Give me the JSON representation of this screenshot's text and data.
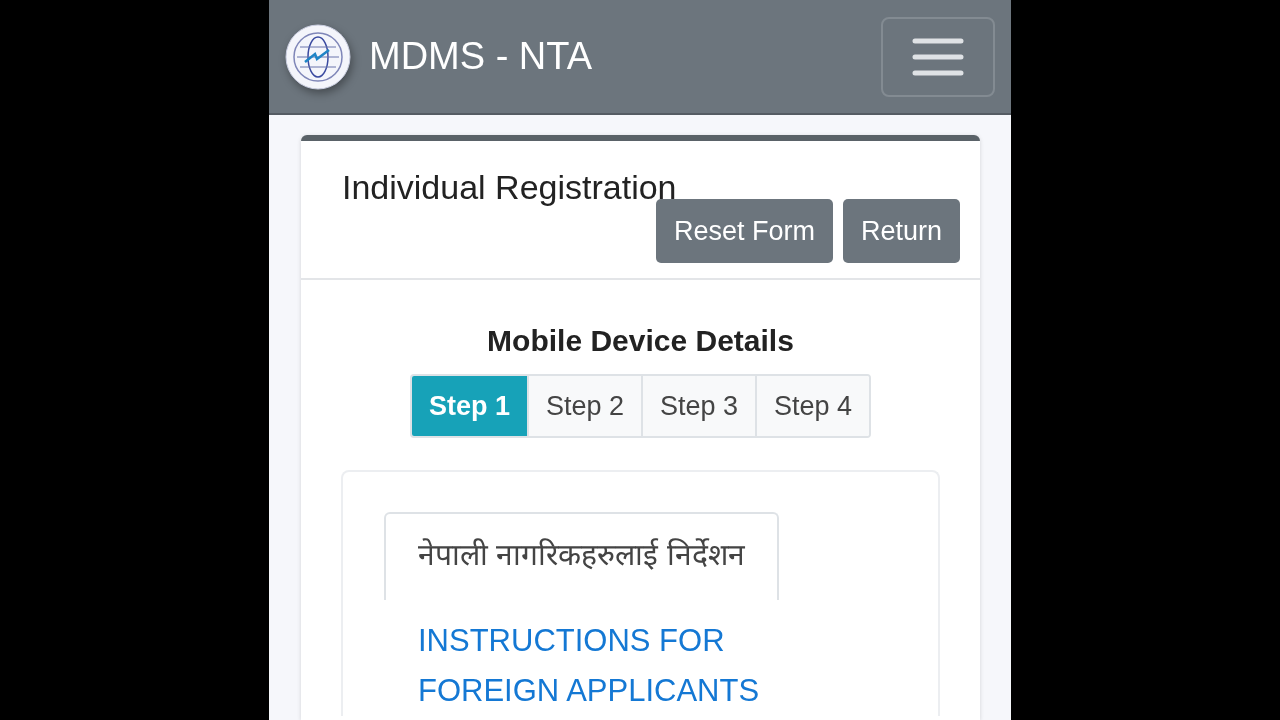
{
  "navbar": {
    "brand": "MDMS - NTA"
  },
  "card": {
    "title": "Individual Registration",
    "buttons": [
      "Reset Form",
      "Return"
    ]
  },
  "section": {
    "heading": "Mobile Device Details"
  },
  "steps": [
    {
      "label": "Step 1",
      "selected": true
    },
    {
      "label": "Step 2",
      "selected": false
    },
    {
      "label": "Step 3",
      "selected": false
    },
    {
      "label": "Step 4",
      "selected": false
    }
  ],
  "instruction_tabs": [
    {
      "label": "नेपाली नागरिकहरुलाई निर्देशन",
      "selected": true
    },
    {
      "label": "INSTRUCTIONS FOR FOREIGN APPLICANTS",
      "selected": false
    }
  ]
}
